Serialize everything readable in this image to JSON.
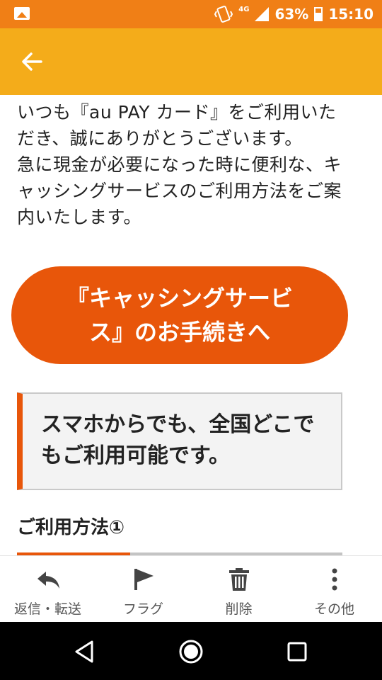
{
  "status_bar": {
    "battery": "63%",
    "time": "15:10",
    "network": "4G",
    "icons": [
      "image-notification-icon",
      "vibrate-icon",
      "signal-icon",
      "battery-icon"
    ]
  },
  "app_bar": {
    "back_icon": "arrow-left-icon"
  },
  "content": {
    "intro_text": "いつも『au PAY カード』をご利用いただき、誠にありがとうございます。\n急に現金が必要になった時に便利な、キャッシングサービスのご利用方法をご案内いたします。",
    "cta_label": "『キャッシングサービス』のお手続きへ",
    "notice_text": "スマホからでも、全国どこでもご利用可能です。",
    "section_title": "ご利用方法①"
  },
  "toolbar": {
    "items": [
      {
        "label": "返信・転送",
        "icon": "reply-icon"
      },
      {
        "label": "フラグ",
        "icon": "flag-icon"
      },
      {
        "label": "削除",
        "icon": "trash-icon"
      },
      {
        "label": "その他",
        "icon": "more-vert-icon"
      }
    ]
  },
  "nav": {
    "icons": [
      "back-triangle-icon",
      "home-circle-icon",
      "recents-square-icon"
    ]
  },
  "colors": {
    "status_bar": "#f07f16",
    "app_bar": "#f4ac1a",
    "accent": "#e8560a"
  }
}
